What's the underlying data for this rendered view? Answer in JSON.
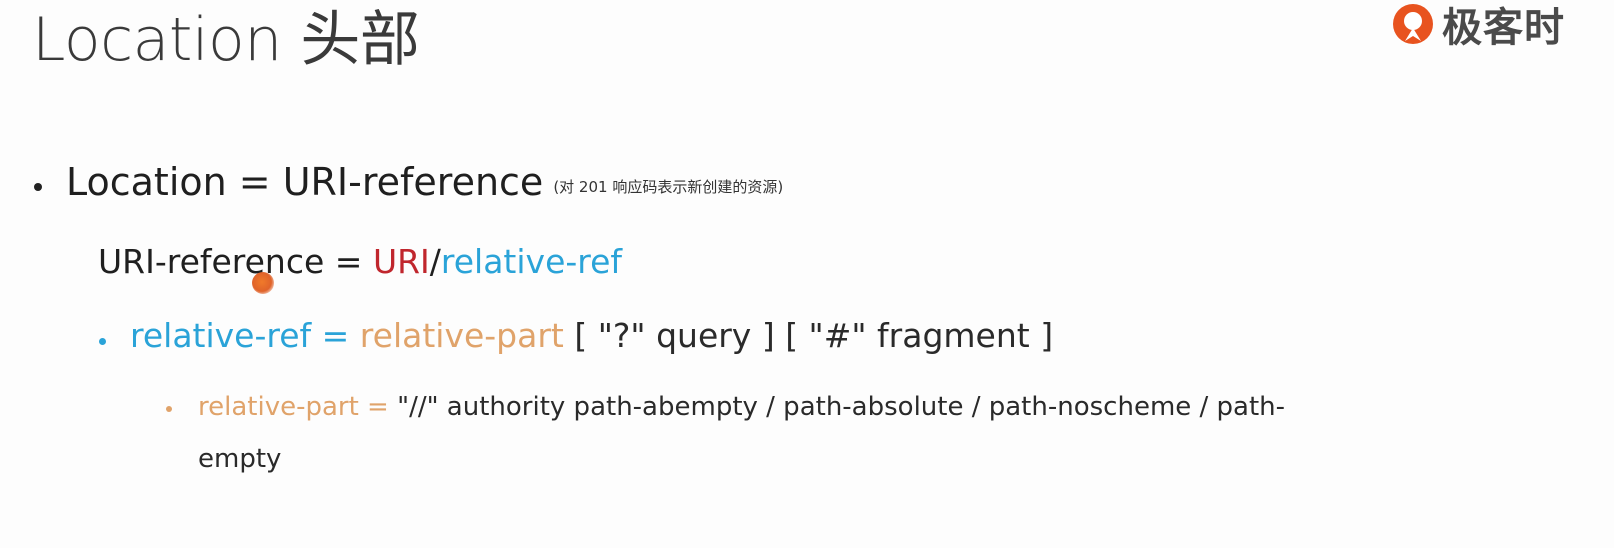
{
  "slide": {
    "title": "Location 头部",
    "logo_text": "极客时",
    "bullet1": {
      "main": "Location = URI-reference",
      "note": "(对 201 响应码表示新创建的资源)"
    },
    "line2": {
      "prefix": "URI-reference = ",
      "uri": "URI",
      "slash": "/",
      "relative": "relative-ref"
    },
    "bullet3": {
      "relative_ref": "relative-ref",
      "eq": " = ",
      "relative_part": "relative-part",
      "rest": " [ \"?\" query ] [ \"#\" fragment ]"
    },
    "bullet4": {
      "relative_part": "relative-part",
      "eq": " = ",
      "rest": "\"//\" authority path-abempty / path-absolute / path-noscheme / path-",
      "continuation": "empty"
    }
  },
  "colors": {
    "uri": "#c0262d",
    "relative_ref": "#2aa3d8",
    "relative_part": "#e0a36a",
    "logo_accent": "#e8531f"
  }
}
